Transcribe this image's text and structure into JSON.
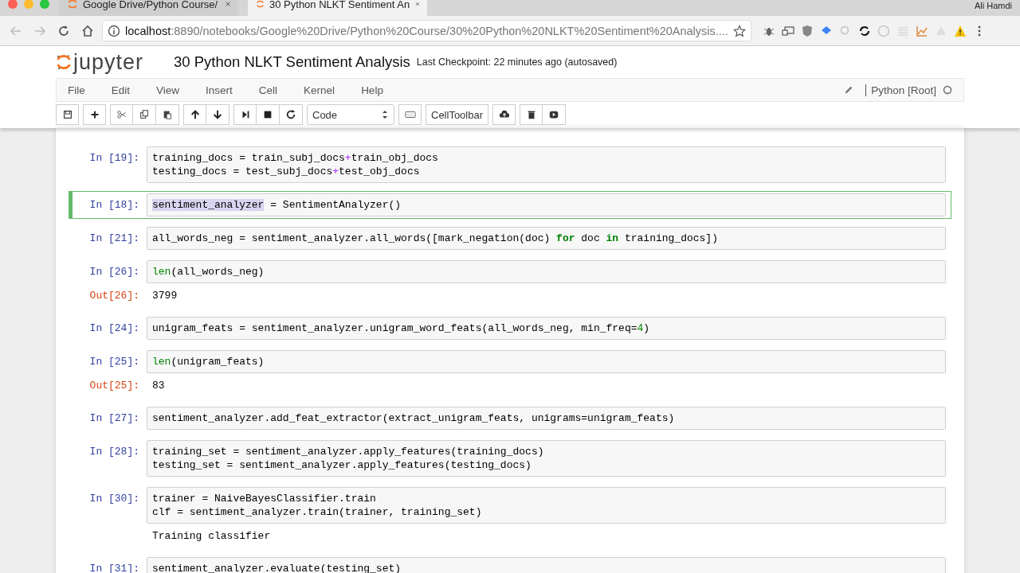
{
  "browser": {
    "tabs": [
      {
        "title": "Google Drive/Python Course/",
        "selected": false
      },
      {
        "title": "30 Python NLKT Sentiment An",
        "selected": true
      }
    ],
    "profile": "Ali Hamdi",
    "url_host": "localhost",
    "url_rest": ":8890/notebooks/Google%20Drive/Python%20Course/30%20Python%20NLKT%20Sentiment%20Analysis...."
  },
  "header": {
    "logo": "jupyter",
    "title": "30 Python NLKT Sentiment Analysis",
    "checkpoint": "Last Checkpoint: 22 minutes ago (autosaved)"
  },
  "menu": [
    "File",
    "Edit",
    "View",
    "Insert",
    "Cell",
    "Kernel",
    "Help"
  ],
  "kernel": "Python [Root]",
  "toolbar": {
    "cell_type": "Code",
    "celltoolbar": "CellToolbar"
  },
  "cells": [
    {
      "prompt": "In [19]:",
      "selected": false,
      "lines": [
        [
          {
            "t": "training_docs = train_subj_docs",
            "kind": "plain"
          },
          {
            "t": "+",
            "kind": "op"
          },
          {
            "t": "train_obj_docs",
            "kind": "plain"
          }
        ],
        [
          {
            "t": "testing_docs = test_subj_docs",
            "kind": "plain"
          },
          {
            "t": "+",
            "kind": "op"
          },
          {
            "t": "test_obj_docs",
            "kind": "plain"
          }
        ]
      ]
    },
    {
      "prompt": "In [18]:",
      "selected": true,
      "lines": [
        [
          {
            "t": "sentiment_analyzer",
            "kind": "sel"
          },
          {
            "t": " = SentimentAnalyzer()",
            "kind": "plain"
          }
        ]
      ]
    },
    {
      "prompt": "In [21]:",
      "selected": false,
      "lines": [
        [
          {
            "t": "all_words_neg = sentiment_analyzer.all_words([mark_negation(doc) ",
            "kind": "plain"
          },
          {
            "t": "for",
            "kind": "kw"
          },
          {
            "t": " doc ",
            "kind": "plain"
          },
          {
            "t": "in",
            "kind": "kw"
          },
          {
            "t": " training_docs])",
            "kind": "plain"
          }
        ]
      ]
    },
    {
      "prompt": "In [26]:",
      "selected": false,
      "lines": [
        [
          {
            "t": "len",
            "kind": "builtin"
          },
          {
            "t": "(all_words_neg)",
            "kind": "plain"
          }
        ]
      ],
      "output": {
        "prompt": "Out[26]:",
        "text": "3799"
      }
    },
    {
      "prompt": "In [24]:",
      "selected": false,
      "lines": [
        [
          {
            "t": "unigram_feats = sentiment_analyzer.unigram_word_feats(all_words_neg, min_freq=",
            "kind": "plain"
          },
          {
            "t": "4",
            "kind": "num"
          },
          {
            "t": ")",
            "kind": "plain"
          }
        ]
      ]
    },
    {
      "prompt": "In [25]:",
      "selected": false,
      "lines": [
        [
          {
            "t": "len",
            "kind": "builtin"
          },
          {
            "t": "(unigram_feats)",
            "kind": "plain"
          }
        ]
      ],
      "output": {
        "prompt": "Out[25]:",
        "text": "83"
      }
    },
    {
      "prompt": "In [27]:",
      "selected": false,
      "lines": [
        [
          {
            "t": "sentiment_analyzer.add_feat_extractor(extract_unigram_feats, unigrams=unigram_feats)",
            "kind": "plain"
          }
        ]
      ]
    },
    {
      "prompt": "In [28]:",
      "selected": false,
      "lines": [
        [
          {
            "t": "training_set = sentiment_analyzer.apply_features(training_docs)",
            "kind": "plain"
          }
        ],
        [
          {
            "t": "testing_set = sentiment_analyzer.apply_features(testing_docs)",
            "kind": "plain"
          }
        ]
      ]
    },
    {
      "prompt": "In [30]:",
      "selected": false,
      "lines": [
        [
          {
            "t": "trainer = NaiveBayesClassifier.train",
            "kind": "plain"
          }
        ],
        [
          {
            "t": "clf = sentiment_analyzer.train(trainer, training_set)",
            "kind": "plain"
          }
        ]
      ],
      "output": {
        "text": "Training classifier"
      }
    },
    {
      "prompt": "In [31]:",
      "selected": false,
      "lines": [
        [
          {
            "t": "sentiment_analyzer.evaluate(testing_set)",
            "kind": "plain"
          }
        ]
      ]
    }
  ]
}
